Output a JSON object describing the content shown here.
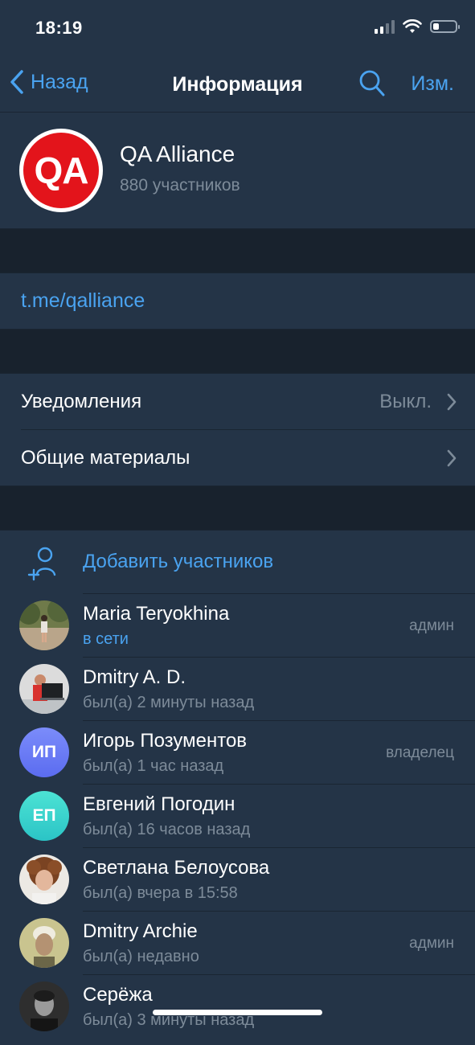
{
  "status_bar": {
    "time": "18:19"
  },
  "nav": {
    "back_label": "Назад",
    "title": "Информация",
    "edit_label": "Изм."
  },
  "group": {
    "avatar_text": "QA",
    "name": "QA Alliance",
    "members_count": "880 участников"
  },
  "link": "t.me/qalliance",
  "settings": {
    "notifications_label": "Уведомления",
    "notifications_value": "Выкл.",
    "shared_media_label": "Общие материалы"
  },
  "members": {
    "add_label": "Добавить участников",
    "list": [
      {
        "name": "Maria Teryokhina",
        "status": "в сети",
        "role": "админ",
        "online": true
      },
      {
        "name": "Dmitry A. D.",
        "status": "был(а) 2 минуты назад",
        "role": ""
      },
      {
        "name": "Игорь Позументов",
        "status": "был(а) 1 час назад",
        "role": "владелец",
        "initials": "ИП"
      },
      {
        "name": "Евгений Погодин",
        "status": "был(а) 16 часов назад",
        "role": "",
        "initials": "ЕП"
      },
      {
        "name": "Светлана Белоусова",
        "status": "был(а) вчера в 15:58",
        "role": ""
      },
      {
        "name": "Dmitry Archie",
        "status": "был(а) недавно",
        "role": "админ"
      },
      {
        "name": "Серёжа",
        "status": "был(а) 3 минуты назад",
        "role": ""
      }
    ]
  },
  "colors": {
    "accent": "#4aa3f0",
    "background": "#18222d",
    "surface": "#243447",
    "brand_red": "#e3141b"
  }
}
